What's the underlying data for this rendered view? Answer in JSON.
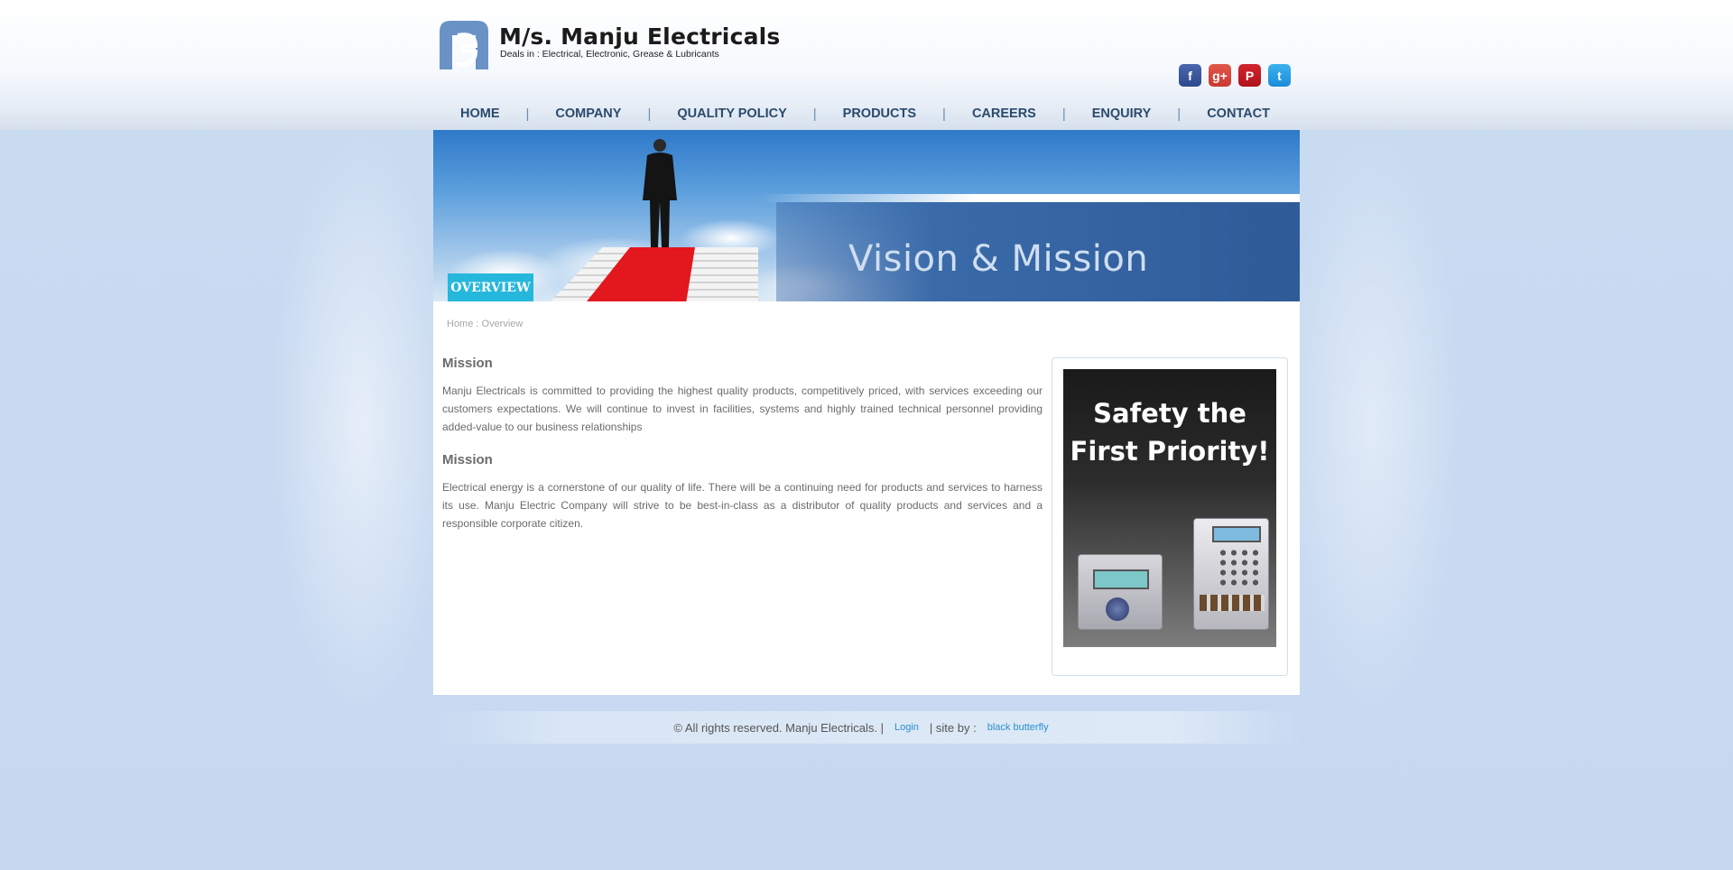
{
  "header": {
    "title": "M/s. Manju Electricals",
    "subtitle": "Deals in : Electrical, Electronic, Grease & Lubricants"
  },
  "social": [
    {
      "name": "facebook-icon",
      "glyph": "f"
    },
    {
      "name": "google-plus-icon",
      "glyph": "g+"
    },
    {
      "name": "pinterest-icon",
      "glyph": "P"
    },
    {
      "name": "twitter-icon",
      "glyph": "t"
    }
  ],
  "nav": [
    "HOME",
    "COMPANY",
    "QUALITY POLICY",
    "PRODUCTS",
    "CAREERS",
    "ENQUIRY",
    "CONTACT"
  ],
  "nav_separator": "|",
  "banner": {
    "heading": "Vision & Mission",
    "tag": "OVERVIEW"
  },
  "breadcrumb": "Home : Overview",
  "sections": [
    {
      "title": "Mission",
      "text": "Manju Electricals is committed to providing the highest quality products, competitively priced, with services exceeding our customers expectations. We will continue to invest in facilities, systems and highly trained technical personnel providing added-value to our business relationships"
    },
    {
      "title": "Mission",
      "text": "Electrical energy is a cornerstone of our quality of life. There will be a continuing need for products and services to harness its use. Manju Electric Company will strive to be best-in-class as a distributor of quality products and services and a responsible corporate citizen."
    }
  ],
  "promo": {
    "line1": "Safety the",
    "line2": "First Priority!"
  },
  "footer": {
    "copyright": "© All rights reserved. Manju Electricals. |",
    "login": "Login",
    "site_by": "| site by :",
    "credit": "black butterfly"
  },
  "colors": {
    "nav_text": "#2b4a6c",
    "overview_tag": "#26b7dc",
    "link": "#2a8fd0"
  }
}
